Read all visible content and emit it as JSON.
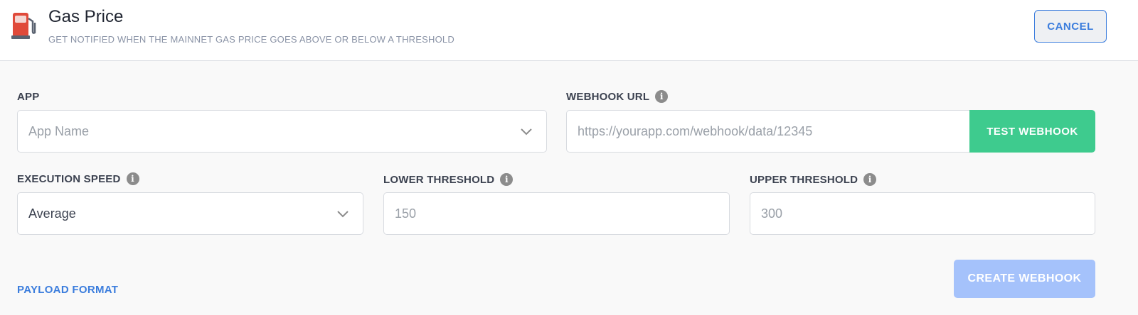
{
  "header": {
    "title": "Gas Price",
    "subtitle": "GET NOTIFIED WHEN THE MAINNET GAS PRICE GOES ABOVE OR BELOW A THRESHOLD",
    "icon": "fuel-pump-icon",
    "cancel_label": "CANCEL"
  },
  "form": {
    "app": {
      "label": "APP",
      "placeholder": "App Name"
    },
    "webhook_url": {
      "label": "WEBHOOK URL",
      "placeholder": "https://yourapp.com/webhook/data/12345",
      "test_label": "TEST WEBHOOK"
    },
    "execution_speed": {
      "label": "EXECUTION SPEED",
      "value": "Average"
    },
    "lower_threshold": {
      "label": "LOWER THRESHOLD",
      "placeholder": "150"
    },
    "upper_threshold": {
      "label": "UPPER THRESHOLD",
      "placeholder": "300"
    }
  },
  "footer": {
    "payload_link": "PAYLOAD FORMAT",
    "create_label": "CREATE WEBHOOK"
  },
  "colors": {
    "accent_blue": "#3b7ddd",
    "test_green": "#3ecb8e",
    "create_disabled": "#a5c2fb"
  }
}
